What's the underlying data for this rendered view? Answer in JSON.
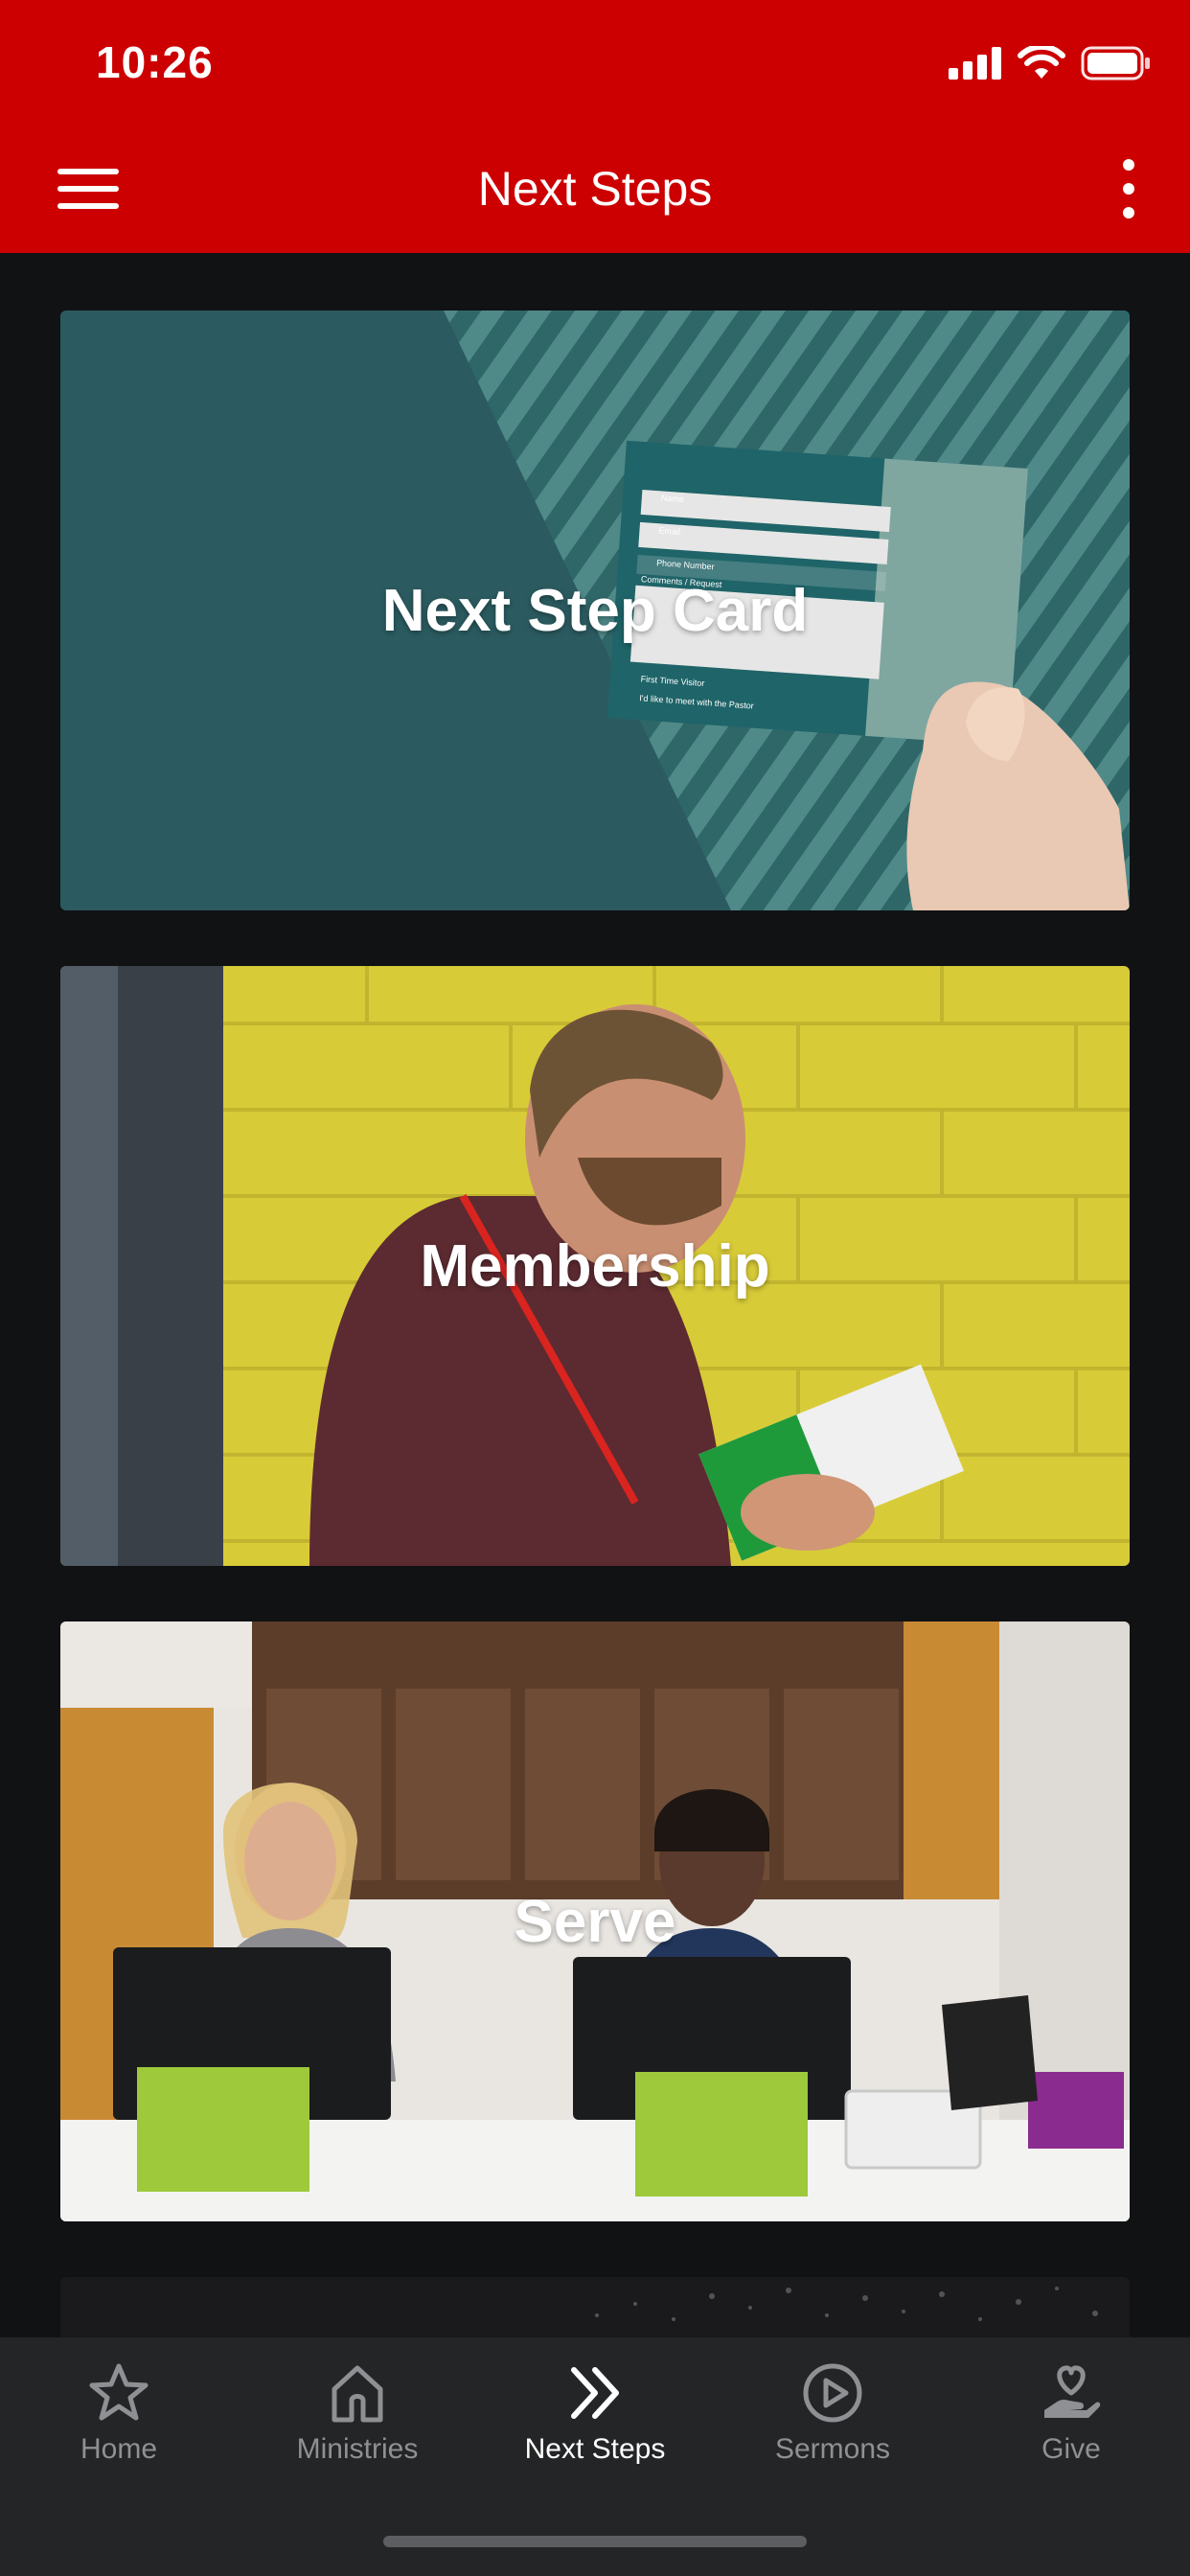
{
  "status_bar": {
    "time": "10:26"
  },
  "header": {
    "title": "Next Steps",
    "background": "#cc0000"
  },
  "cards": [
    {
      "label": "Next Step Card"
    },
    {
      "label": "Membership"
    },
    {
      "label": "Serve"
    },
    {
      "label": ""
    }
  ],
  "next_step_card_form": {
    "fields": [
      "Name",
      "Email",
      "Phone Number",
      "Comments / Request"
    ],
    "checkboxes": [
      "First Time Visitor",
      "I'd like to meet with the Pastor"
    ]
  },
  "tabs": [
    {
      "label": "Home",
      "icon": "star-icon",
      "active": false
    },
    {
      "label": "Ministries",
      "icon": "church-icon",
      "active": false
    },
    {
      "label": "Next Steps",
      "icon": "double-chevron-right-icon",
      "active": true
    },
    {
      "label": "Sermons",
      "icon": "play-circle-icon",
      "active": false
    },
    {
      "label": "Give",
      "icon": "heart-hand-icon",
      "active": false
    }
  ]
}
